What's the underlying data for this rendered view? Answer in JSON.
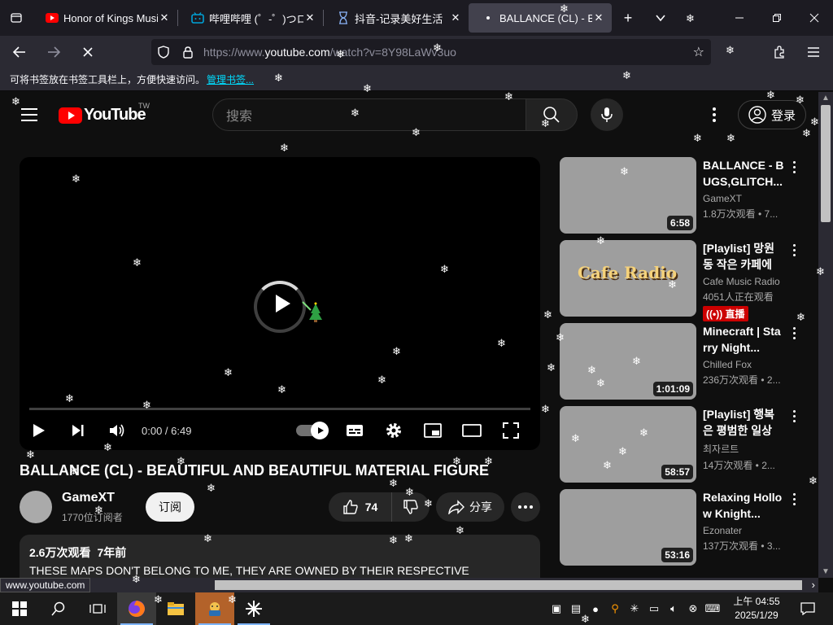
{
  "browser": {
    "tabs": [
      {
        "title": "Honor of Kings Musi",
        "icon": "youtube-icon",
        "close": "✕"
      },
      {
        "title": "哔哩哔哩 (゜-゜)つロ 干",
        "icon": "bilibili-icon",
        "close": "✕"
      },
      {
        "title": "抖音-记录美好生活",
        "icon": "douyin-icon",
        "close": "✕"
      },
      {
        "title": "BALLANCE (CL) - BEA",
        "icon": "loading-icon",
        "close": "✕"
      }
    ],
    "new_tab": "+",
    "url_dim_prefix": "https://www.",
    "url_domain": "youtube.com",
    "url_suffix": "/watch?v=8Y98LaWv3uo",
    "bookmark_hint": "可将书签放在书签工具栏上，方便快速访问。",
    "bookmark_link": "管理书签..."
  },
  "youtube": {
    "logo_text": "YouTube",
    "region": "TW",
    "search_placeholder": "搜索",
    "signin_label": "登录",
    "player": {
      "time": "0:00 / 6:49",
      "progress": 0
    },
    "video": {
      "title": "BALLANCE (CL) - BEAUTIFUL AND BEAUTIFUL MATERIAL FIGURE",
      "channel": "GameXT",
      "subscribers": "1770位订阅者",
      "subscribe_label": "订阅",
      "likes": "74",
      "share_label": "分享",
      "views": "2.6万次观看",
      "age": "7年前",
      "description": "THESE MAPS DON'T BELONG TO ME, THEY ARE OWNED BY THEIR RESPECTIVE CREATORS."
    },
    "recommendations": [
      {
        "title": "BALLANCE - BUGS,GLITCH...",
        "channel": "GameXT",
        "views": "1.8万次观看 • 7...",
        "duration": "6:58"
      },
      {
        "title": "[Playlist] 망원동 작은 카페에서...",
        "channel": "Cafe Music Radio",
        "views": "4051人正在观看",
        "live": "((•)) 直播",
        "thumb_text": "Cafe Radio"
      },
      {
        "title": "Minecraft | Starry Night...",
        "channel": "Chilled Fox",
        "views": "236万次观看 • 2...",
        "duration": "1:01:09"
      },
      {
        "title": "[Playlist] 행복은 평범한 일상 ...",
        "channel": "최자르트",
        "views": "14万次观看 • 2...",
        "duration": "58:57"
      },
      {
        "title": "Relaxing Hollow Knight...",
        "channel": "Ezonater",
        "views": "137万次观看 • 3...",
        "duration": "53:16"
      }
    ]
  },
  "statusbar": {
    "text": "www.youtube.com"
  },
  "taskbar": {
    "time": "上午 04:55",
    "date": "2025/1/29"
  }
}
